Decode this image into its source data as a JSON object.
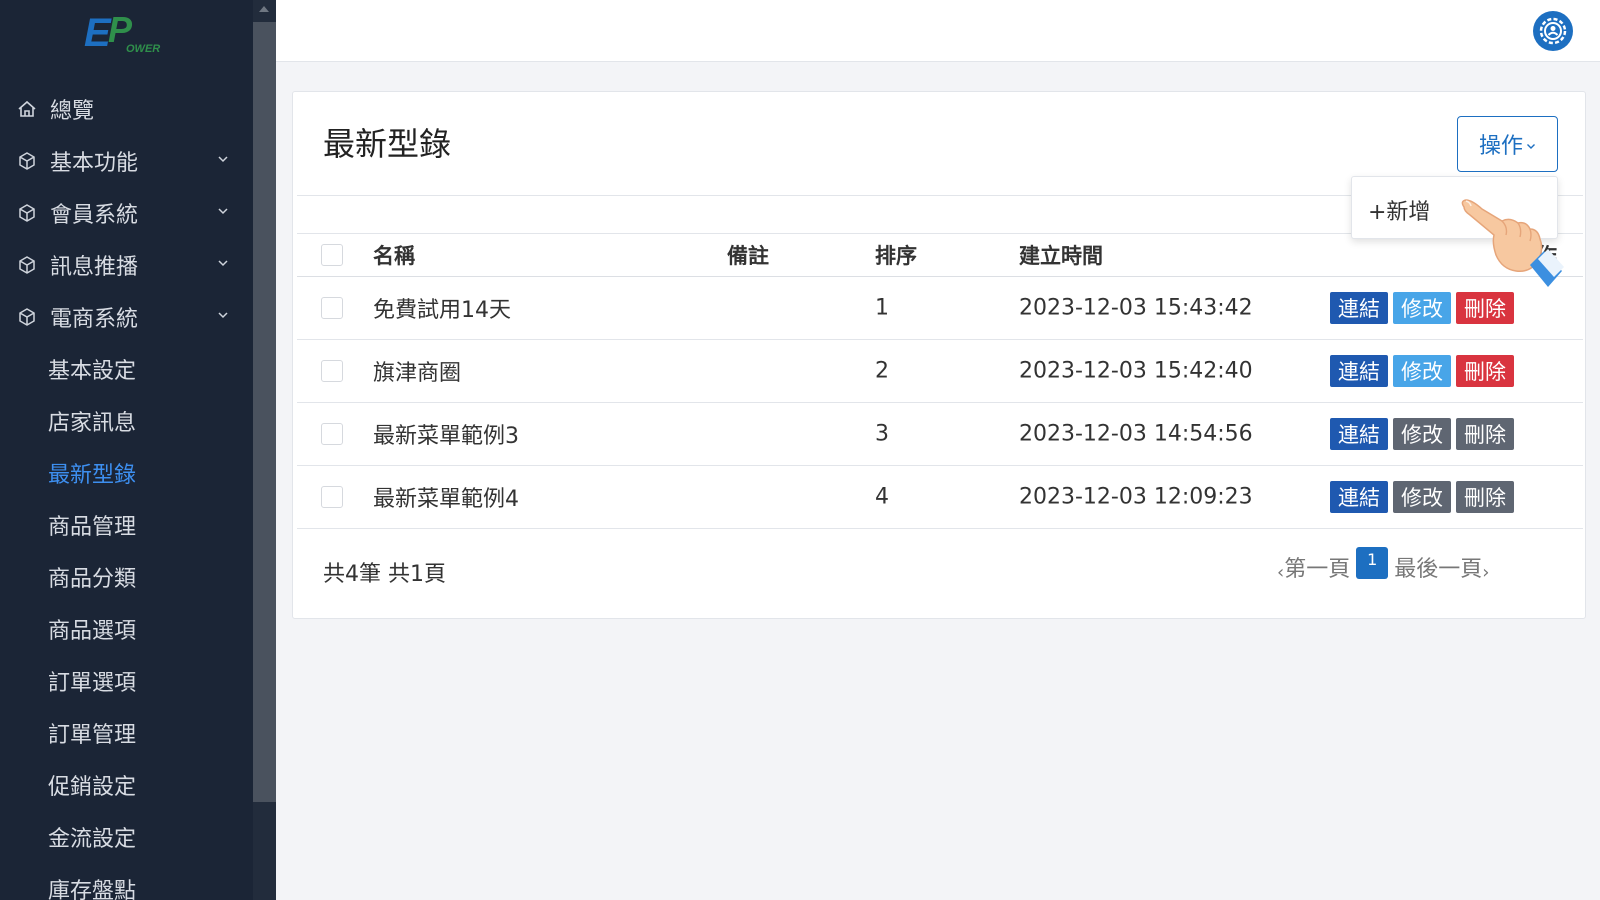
{
  "logo": {
    "text": "EPower",
    "brand_color": "#1d6fc1",
    "accent": "#2f8f4b"
  },
  "sidebar": {
    "items": [
      {
        "label": "總覽",
        "icon": "home-icon",
        "expandable": false
      },
      {
        "label": "基本功能",
        "icon": "cube-icon",
        "expandable": true
      },
      {
        "label": "會員系統",
        "icon": "cube-icon",
        "expandable": true
      },
      {
        "label": "訊息推播",
        "icon": "cube-icon",
        "expandable": true
      },
      {
        "label": "電商系統",
        "icon": "cube-icon",
        "expandable": true
      }
    ],
    "subitems": [
      {
        "label": "基本設定"
      },
      {
        "label": "店家訊息"
      },
      {
        "label": "最新型錄",
        "active": true
      },
      {
        "label": "商品管理"
      },
      {
        "label": "商品分類"
      },
      {
        "label": "商品選項"
      },
      {
        "label": "訂單選項"
      },
      {
        "label": "訂單管理"
      },
      {
        "label": "促銷設定"
      },
      {
        "label": "金流設定"
      },
      {
        "label": "庫存盤點"
      }
    ]
  },
  "page": {
    "title": "最新型錄",
    "ops_label": "操作",
    "dropdown_new": "+新增"
  },
  "table": {
    "headers": {
      "name": "名稱",
      "note": "備註",
      "order": "排序",
      "created": "建立時間",
      "actions": "操作"
    },
    "rows": [
      {
        "name": "免費試用14天",
        "note": "",
        "order": "1",
        "created": "2023-12-03 15:43:42",
        "link": "連結",
        "edit": "修改",
        "delete": "刪除",
        "enabled": true
      },
      {
        "name": "旗津商圈",
        "note": "",
        "order": "2",
        "created": "2023-12-03 15:42:40",
        "link": "連結",
        "edit": "修改",
        "delete": "刪除",
        "enabled": true
      },
      {
        "name": "最新菜單範例3",
        "note": "",
        "order": "3",
        "created": "2023-12-03 14:54:56",
        "link": "連結",
        "edit": "修改",
        "delete": "刪除",
        "enabled": false
      },
      {
        "name": "最新菜單範例4",
        "note": "",
        "order": "4",
        "created": "2023-12-03 12:09:23",
        "link": "連結",
        "edit": "修改",
        "delete": "刪除",
        "enabled": false
      }
    ]
  },
  "footer": {
    "count": "共4筆 共1頁",
    "first": "第一頁",
    "page": "1",
    "last": "最後一頁",
    "prev_arrow": "‹",
    "next_arrow": "›"
  },
  "colors": {
    "sidebar_bg": "#1b2536",
    "active": "#3d8ff0",
    "primary": "#1d6fc1",
    "link_btn": "#1f59b0",
    "edit_btn": "#48a5e8",
    "delete_btn": "#d9343f",
    "disabled_btn": "#5f6672"
  }
}
